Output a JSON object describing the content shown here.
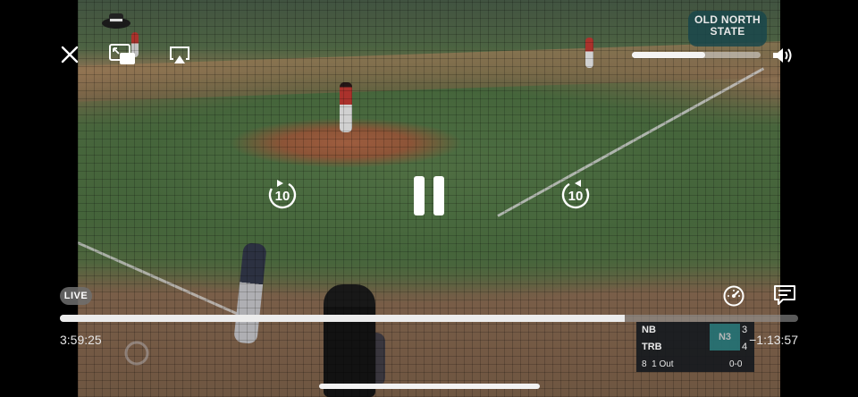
{
  "player": {
    "close_icon": "close-icon",
    "pip_icon": "picture-in-picture-icon",
    "airplay_icon": "airplay-icon",
    "volume_icon": "speaker-icon",
    "volume_level": 0.57,
    "skip_back_label": "10",
    "skip_forward_label": "10",
    "pause_icon": "pause-icon",
    "live_label": "LIVE",
    "speed_icon": "playback-speed-icon",
    "captions_icon": "captions-icon",
    "progress": 0.765,
    "elapsed_time": "3:59:25",
    "remaining_time": "−1:13:57"
  },
  "broadcast": {
    "logo_text": [
      "OLD NORTH",
      "STATE"
    ],
    "scoreboard": {
      "teams": [
        {
          "name": "NB",
          "score": "3"
        },
        {
          "name": "TRB",
          "score": "4"
        }
      ],
      "center_mark": "N3",
      "inning": "8",
      "outs": "1 Out",
      "count": "0-0"
    }
  },
  "colors": {
    "accent": "#ffffff",
    "progress_fill": "#ececec",
    "badge_bg": "#6e6e6e"
  }
}
